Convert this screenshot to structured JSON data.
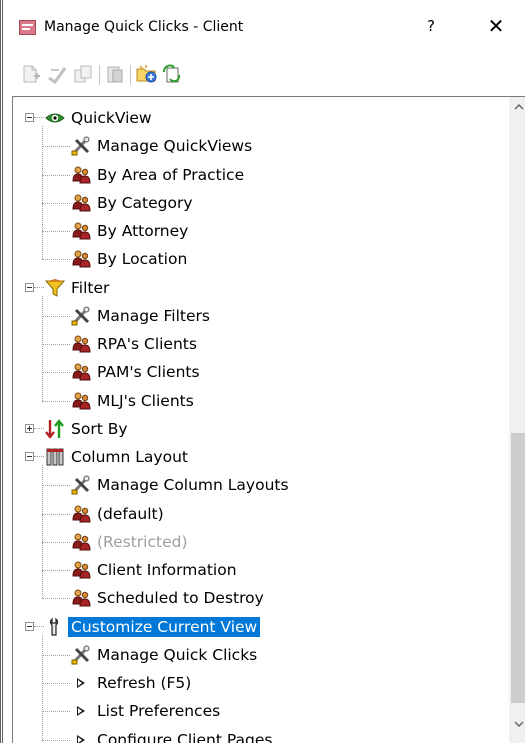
{
  "window": {
    "title": "Manage Quick Clicks - Client",
    "help_label": "?",
    "close_label": "✕"
  },
  "toolbar": [
    {
      "name": "new-item-icon",
      "enabled": false
    },
    {
      "name": "edit-item-icon",
      "enabled": false
    },
    {
      "name": "copy-item-icon",
      "enabled": false
    },
    {
      "name": "delete-item-icon",
      "enabled": false
    },
    {
      "name": "add-folder-icon",
      "enabled": true
    },
    {
      "name": "refresh-icon",
      "enabled": true
    }
  ],
  "tree": {
    "groups": [
      {
        "label": "QuickView",
        "icon": "eye-icon",
        "expanded": true,
        "children": [
          {
            "label": "Manage QuickViews",
            "icon": "tools-icon"
          },
          {
            "label": "By Area of Practice",
            "icon": "people-icon"
          },
          {
            "label": "By Category",
            "icon": "people-icon"
          },
          {
            "label": "By Attorney",
            "icon": "people-icon"
          },
          {
            "label": "By Location",
            "icon": "people-icon"
          }
        ]
      },
      {
        "label": "Filter",
        "icon": "funnel-icon",
        "expanded": true,
        "children": [
          {
            "label": "Manage Filters",
            "icon": "tools-icon"
          },
          {
            "label": "RPA's Clients",
            "icon": "people-icon"
          },
          {
            "label": "PAM's Clients",
            "icon": "people-icon"
          },
          {
            "label": "MLJ's Clients",
            "icon": "people-icon"
          }
        ]
      },
      {
        "label": "Sort By",
        "icon": "sort-icon",
        "expanded": false,
        "children": []
      },
      {
        "label": "Column Layout",
        "icon": "columns-icon",
        "expanded": true,
        "children": [
          {
            "label": "Manage Column Layouts",
            "icon": "tools-icon"
          },
          {
            "label": "(default)",
            "icon": "people-icon"
          },
          {
            "label": "(Restricted)",
            "icon": "people-icon",
            "disabled": true
          },
          {
            "label": "Client Information",
            "icon": "people-icon"
          },
          {
            "label": "Scheduled to Destroy",
            "icon": "people-icon"
          }
        ]
      },
      {
        "label": "Customize Current View",
        "icon": "wrench-icon",
        "expanded": true,
        "selected": true,
        "children": [
          {
            "label": "Manage Quick Clicks",
            "icon": "tools-icon"
          },
          {
            "label": "Refresh (F5)",
            "icon": "arrow-right-icon"
          },
          {
            "label": "List Preferences",
            "icon": "arrow-right-icon"
          },
          {
            "label": "Configure Client Pages",
            "icon": "arrow-right-icon"
          }
        ]
      }
    ]
  },
  "scrollbar": {
    "up_label": "^",
    "down_label": "v",
    "thumb_fraction_start": 0.52,
    "thumb_fraction_size": 0.42
  },
  "colors": {
    "selection": "#0078d7",
    "disabled_text": "#a0a0a0"
  }
}
